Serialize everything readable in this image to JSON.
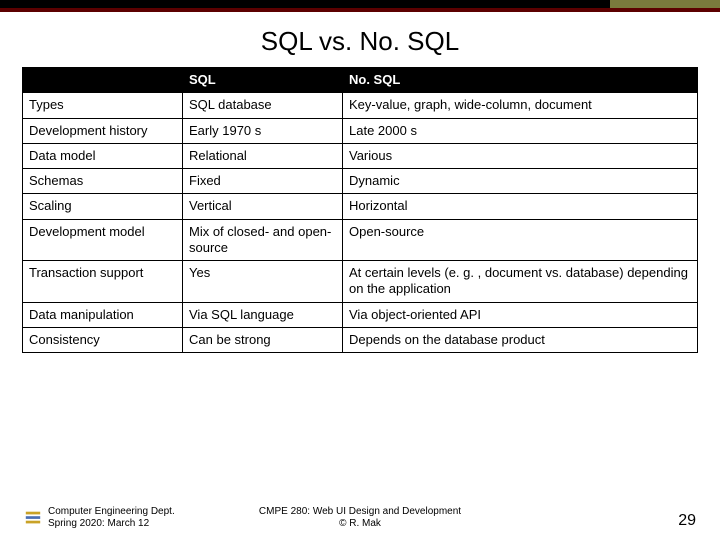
{
  "title": "SQL vs. No. SQL",
  "table": {
    "headers": {
      "c0": "",
      "c1": "SQL",
      "c2": "No. SQL"
    },
    "rows": [
      {
        "label": "Types",
        "sql": "SQL database",
        "nosql": "Key-value, graph, wide-column, document"
      },
      {
        "label": "Development history",
        "sql": "Early 1970 s",
        "nosql": "Late 2000 s"
      },
      {
        "label": "Data model",
        "sql": "Relational",
        "nosql": "Various"
      },
      {
        "label": "Schemas",
        "sql": "Fixed",
        "nosql": "Dynamic"
      },
      {
        "label": "Scaling",
        "sql": "Vertical",
        "nosql": "Horizontal"
      },
      {
        "label": "Development model",
        "sql": "Mix of closed- and open-source",
        "nosql": "Open-source"
      },
      {
        "label": "Transaction support",
        "sql": "Yes",
        "nosql": "At certain levels (e. g. , document vs. database) depending on the application"
      },
      {
        "label": "Data manipulation",
        "sql": "Via SQL language",
        "nosql": "Via object-oriented API"
      },
      {
        "label": "Consistency",
        "sql": "Can be strong",
        "nosql": "Depends on the database product"
      }
    ]
  },
  "footer": {
    "dept_line1": "Computer Engineering Dept.",
    "dept_line2": "Spring 2020: March 12",
    "center_line1": "CMPE 280: Web UI Design and Development",
    "center_line2": "© R. Mak",
    "page": "29",
    "logo_alt": "SJSU"
  }
}
